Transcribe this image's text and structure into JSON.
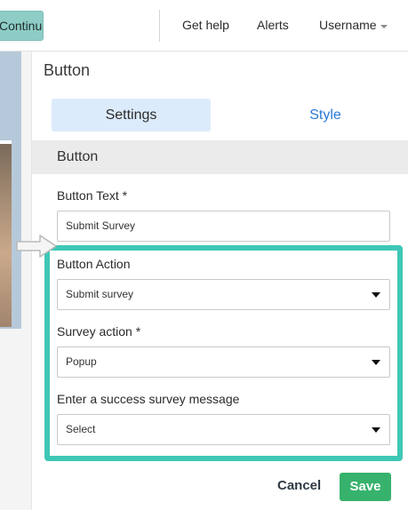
{
  "topbar": {
    "continue_label": "Continue",
    "get_help": "Get help",
    "alerts": "Alerts",
    "username": "Username"
  },
  "panel": {
    "title": "Button",
    "tabs": [
      {
        "label": "Settings",
        "active": true
      },
      {
        "label": "Style",
        "active": false
      }
    ],
    "section_title": "Button",
    "fields": {
      "button_text": {
        "label": "Button Text *",
        "value": "Submit Survey"
      },
      "button_action": {
        "label": "Button Action",
        "value": "Submit survey"
      },
      "survey_action": {
        "label": "Survey action *",
        "value": "Popup"
      },
      "success_message": {
        "label": "Enter a success survey message",
        "value": "Select"
      }
    },
    "footer": {
      "cancel": "Cancel",
      "save": "Save"
    }
  },
  "colors": {
    "accent_teal": "#3fc7b6",
    "tab_active_bg": "#dcebfb",
    "link_blue": "#2979d9",
    "save_green": "#37b26c",
    "continue_bg": "#8ecdc6"
  },
  "icons": [
    "caret-down-icon",
    "select-arrow-icon",
    "pointer-arrow-icon"
  ]
}
